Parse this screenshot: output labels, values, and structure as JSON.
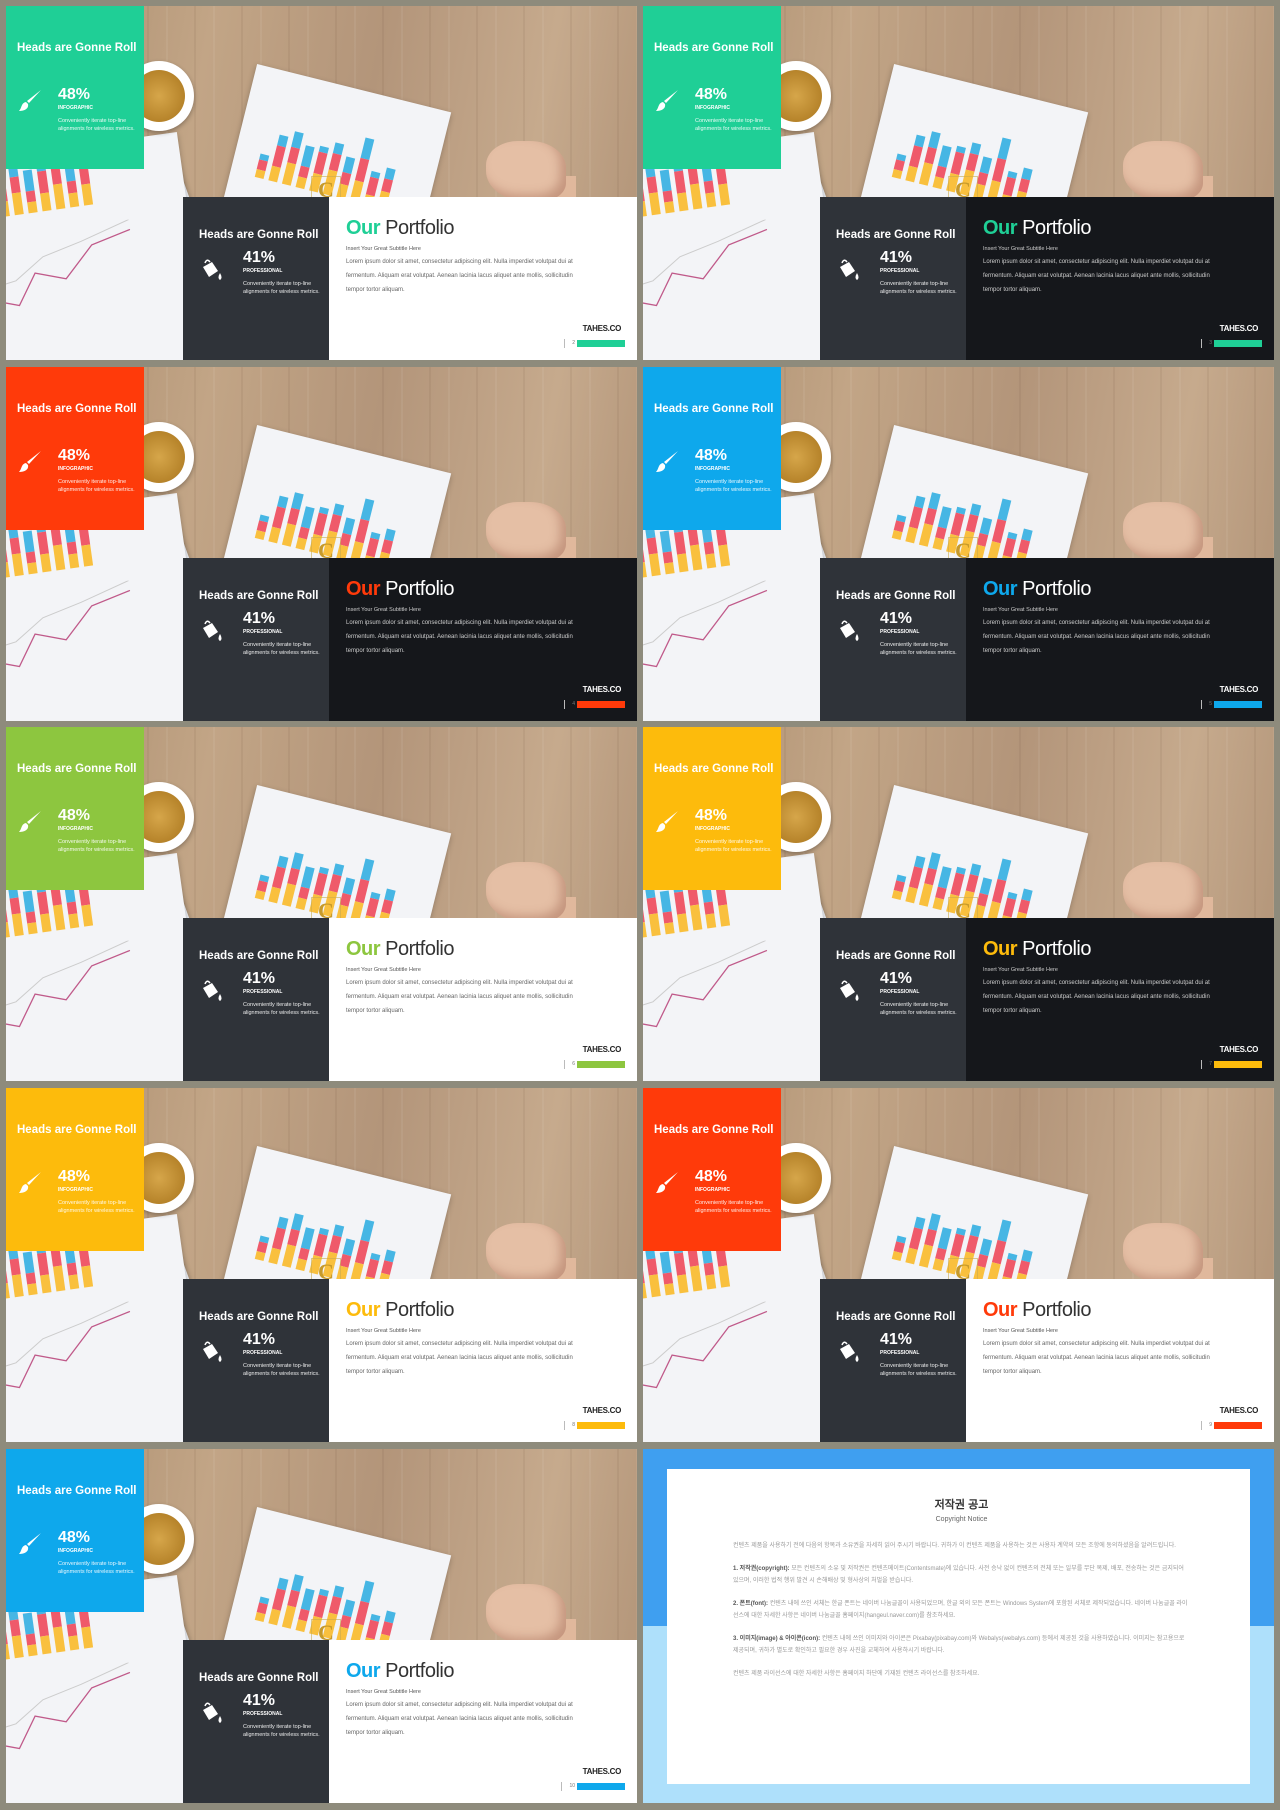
{
  "slides": [
    {
      "accent": "#1fcf96",
      "theme": "light",
      "page": "2"
    },
    {
      "accent": "#1fcf96",
      "theme": "dark",
      "page": "3"
    },
    {
      "accent": "#ff3a0a",
      "theme": "dark",
      "page": "4"
    },
    {
      "accent": "#0ea8ec",
      "theme": "dark",
      "page": "5"
    },
    {
      "accent": "#8dc63f",
      "theme": "light",
      "page": "6"
    },
    {
      "accent": "#fdbb0c",
      "theme": "dark",
      "page": "7"
    },
    {
      "accent": "#fdbb0c",
      "theme": "light",
      "page": "8"
    },
    {
      "accent": "#ff3a0a",
      "theme": "light",
      "page": "9"
    },
    {
      "accent": "#0ea8ec",
      "theme": "light",
      "page": "10"
    }
  ],
  "content": {
    "box_title": "Heads are Gonne Roll",
    "stat1": {
      "value": "48%",
      "label": "INFOGRAPHIC",
      "desc": "Conveniently iterate top-line alignments for wireless metrics.",
      "icon": "paint-brush-icon"
    },
    "stat2": {
      "value": "41%",
      "label": "PROFESSIONAL",
      "desc": "Conveniently iterate top-line alignments for wireless metrics.",
      "icon": "paint-bucket-icon"
    },
    "title_accent": "Our",
    "title_rest": " Portfolio",
    "subtitle": "Insert Your Great Subtitle Here",
    "body": "Lorem ipsum dolor sit amet, consectetur adipiscing elit. Nulla imperdiet volutpat dui at fermentum. Aliquam erat volutpat. Aenean lacinia lacus aliquet ante mollis, sollicitudin tempor tortor aliquam.",
    "brand": "TAHES.CO"
  },
  "copyright": {
    "title": "저작권 공고",
    "subtitle": "Copyright Notice",
    "intro": "컨텐츠 제품을 사용하기 전에 다음의 항목과 소유권을 자세히 읽어 주시기 바랍니다. 귀하가 이 컨텐츠 제품을 사용하는 것은 사용자 계약의 모든 조항에 동의하셨음을 알려드립니다.",
    "s1_head": "1. 저작권(copyright):",
    "s1_body": " 모든 컨텐츠의 소유 및 저작권은 컨텐츠메이트(Contentsmate)에 있습니다. 사전 승낙 없이 컨텐츠의 전체 또는 일부를 무단 복제, 배포, 전송하는 것은 금지되어 있으며, 이러한 법적 행위 발견 시 손해배상 및 형사상의 처벌을 받습니다.",
    "s2_head": "2. 폰트(font):",
    "s2_body": " 컨텐츠 내에 쓰인 서체는 한글 폰트는 네이버 나눔글꼴이 사용되었으며, 한글 외의 모든 폰트는 Windows System에 포함된 서체로 제작되었습니다. 네이버 나눔글꼴 라이선스에 대한 자세한 사항은 네이버 나눔글꼴 홈페이지(hangeul.naver.com)를 참조하세요.",
    "s3_head": "3. 이미지(image) & 아이콘(icon):",
    "s3_body": " 컨텐츠 내에 쓰인 이미지와 아이콘은 Pixabay(pixabay.com)와 Webalys(webalys.com) 등에서 제공된 것을 사용하였습니다. 이미지는 참고용으로 제공되며, 귀하가 별도로 확인하고 필요한 경우 사진을 교체하여 사용하시기 바랍니다.",
    "outro": "컨텐츠 제품 라이선스에 대한 자세한 사항은 홈페이지 하단에 기재된 컨텐츠 라이선스를 참조하세요."
  }
}
